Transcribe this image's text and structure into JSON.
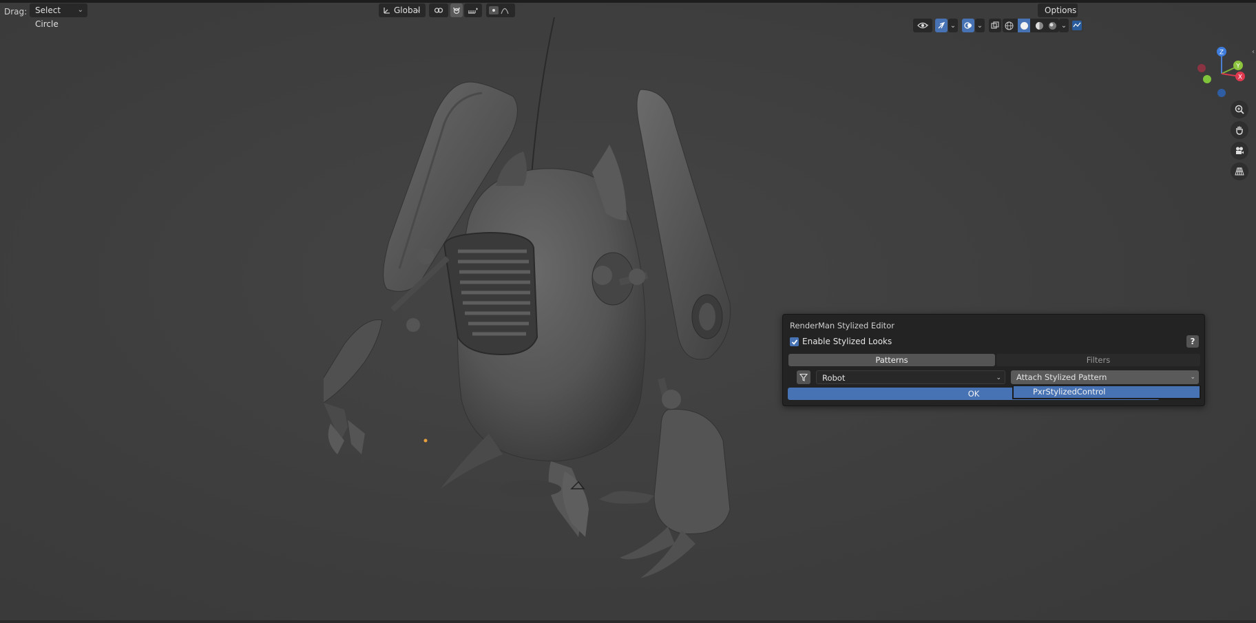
{
  "header": {
    "drag_label": "Drag:",
    "drag_mode": "Select Circle",
    "transform_orientation": "Global",
    "options_label": "Options"
  },
  "viewport_icons": [
    "view-object-types-icon",
    "gizmo-icon",
    "overlays-icon",
    "xray-icon",
    "wireframe-shading-icon",
    "solid-shading-icon",
    "material-shading-icon",
    "rendered-shading-icon",
    "ipr-icon"
  ],
  "gizmo": {
    "x_label": "X",
    "y_label": "Y",
    "z_label": "Z"
  },
  "dialog": {
    "title": "RenderMan Stylized Editor",
    "enable_label": "Enable Stylized Looks",
    "enable_checked": true,
    "help_label": "?",
    "tabs": [
      {
        "label": "Patterns",
        "active": true
      },
      {
        "label": "Filters",
        "active": false
      }
    ],
    "object_select": "Robot",
    "pattern_select": "Attach Stylized Pattern",
    "ok_label": "OK",
    "menu_items": [
      "PxrStylizedControl"
    ]
  },
  "colors": {
    "accent": "#4772b3",
    "background": "#3d3d3d",
    "panel": "#232323"
  }
}
